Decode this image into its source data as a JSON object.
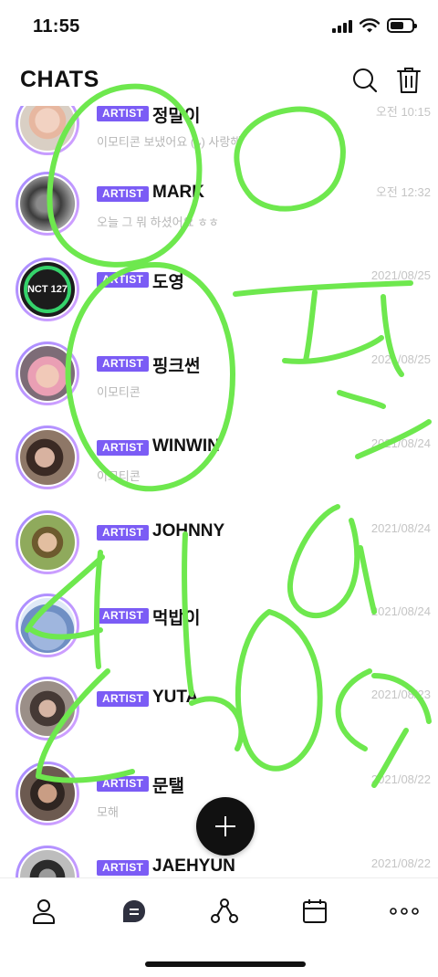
{
  "status_bar": {
    "time": "11:55"
  },
  "header": {
    "title": "CHATS",
    "search_icon": "search-icon",
    "trash_icon": "trash-icon"
  },
  "badge_label": "ARTIST",
  "chats": [
    {
      "name": "정말이",
      "preview": "이모티콘 보냈어요 (ᴗ) 사랑해",
      "time": "오전 10:15"
    },
    {
      "name": "MARK",
      "preview": "오늘 그 뭐 하셨어요 ㅎㅎ",
      "time": "오전 12:32"
    },
    {
      "name": "도영",
      "preview": "",
      "time": "2021/08/25"
    },
    {
      "name": "핑크썬",
      "preview": "이모티콘",
      "time": "2021/08/25"
    },
    {
      "name": "WINWIN",
      "preview": "이모티콘",
      "time": "2021/08/24"
    },
    {
      "name": "JOHNNY",
      "preview": "",
      "time": "2021/08/24"
    },
    {
      "name": "먹밥이",
      "preview": "",
      "time": "2021/08/24"
    },
    {
      "name": "YUTA",
      "preview": "",
      "time": "2021/08/23"
    },
    {
      "name": "문탤",
      "preview": "모해",
      "time": "2021/08/22"
    },
    {
      "name": "JAEHYUN",
      "preview": "",
      "time": "2021/08/22"
    }
  ],
  "tabs": [
    {
      "name": "profile",
      "icon": "person-icon"
    },
    {
      "name": "chats",
      "icon": "chat-bubble-icon",
      "active": true
    },
    {
      "name": "share",
      "icon": "share-icon"
    },
    {
      "name": "calendar",
      "icon": "calendar-icon"
    },
    {
      "name": "more",
      "icon": "more-dots-icon"
    }
  ],
  "avatar_text": {
    "nct": "NCT 127"
  },
  "colors": {
    "accent": "#7b5cf5",
    "scribble": "#6ee84e"
  }
}
